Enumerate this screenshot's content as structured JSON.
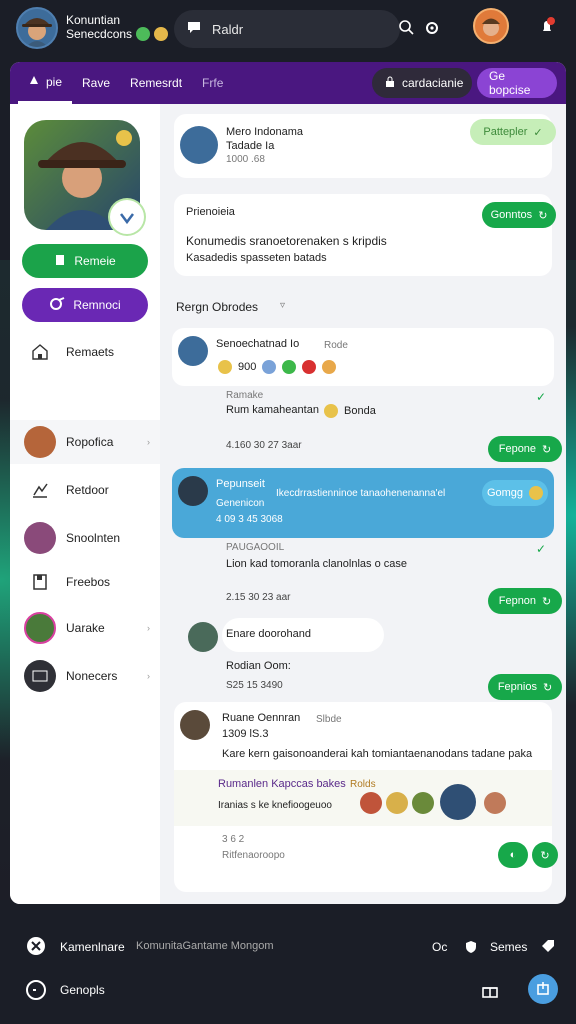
{
  "colors": {
    "brand_purple": "#4a1780",
    "accent_green": "#17a84a",
    "accent_purple": "#6a28b4",
    "highlight_blue": "#4aa8d8"
  },
  "header": {
    "title": "Konuntian",
    "subtitle": "Senecdcons",
    "search_placeholder": "Raldr",
    "icons": [
      "search-icon",
      "settings-icon",
      "notification-icon"
    ]
  },
  "tabs": [
    {
      "label": "pie",
      "icon": "grid-icon"
    },
    {
      "label": "Rave"
    },
    {
      "label": "Remesrdt"
    },
    {
      "label": "Frfe"
    }
  ],
  "tab_actions": {
    "secondary_label": "cardacianie",
    "primary_label": "Ge bopcise"
  },
  "sidebar": {
    "primary_button": "Remeie",
    "secondary_button": "Remnoci",
    "items": [
      {
        "label": "Remaets",
        "icon": "home-icon"
      },
      {
        "label": "Ropofica",
        "icon": "avatar"
      },
      {
        "label": "Retdoor",
        "icon": "chart-icon"
      },
      {
        "label": "Snoolnten",
        "icon": "avatar"
      },
      {
        "label": "Freebos",
        "icon": "document-icon"
      },
      {
        "label": "Uarake",
        "icon": "avatar"
      },
      {
        "label": "Nonecers",
        "icon": "board-icon"
      }
    ]
  },
  "feed": {
    "post1": {
      "name": "Mero Indonama",
      "meta1": "Tadade Ia",
      "meta2": "1000 .68",
      "badge": "Pattepler"
    },
    "summary": {
      "title": "Prienoieia",
      "line1": "Konumedis sranoetorenaken s kripdis",
      "line2": "Kasadedis spasseten batads",
      "button": "Gonntos"
    },
    "section_title": "Rergn Obrodes",
    "comment1": {
      "name": "Senoechatnad Io",
      "meta": "Rode",
      "count": "900"
    },
    "reply1": {
      "meta": "Ramake",
      "text": "Rum kamaheantan",
      "tag": "Bonda",
      "stats": "4.160  30  27 3aar",
      "button": "Fepone"
    },
    "highlight": {
      "name": "Pepunseit",
      "sub": "Genenicon",
      "stats": "4 09 3 45 3068",
      "message": "Ikecdrrastienninoe tanaohenenanna'el",
      "button": "Gomgg"
    },
    "reply2": {
      "meta": "PAUGAOOIL",
      "text": "Lion kad tomoranla clanolnlas o case",
      "stats": "2.15  30  23 aar",
      "button": "Fepnon"
    },
    "chip": {
      "text": "Enare doorohand"
    },
    "reply3": {
      "name": "Rodian Oom:",
      "stats": "S25  15  3490",
      "button": "Fepnios"
    },
    "post2": {
      "name": "Ruane Oennran",
      "meta": "Slbde",
      "meta2": "1309 lS.3",
      "text": "Kare kern gaisonoanderai kah tomiantaenanodans tadane paka",
      "subcard": "Rumanlen Kapccas bakes",
      "subcard_tag": "Rolds",
      "sub_meta": "Iranias s ke knefioogeuoo",
      "footer1": "3 6  2",
      "footer2": "Ritfenaoroopo"
    }
  },
  "bottombar": {
    "title": "Kamenlnare",
    "subtitle": "KomunitaGantame Mongom",
    "status": "Oc",
    "settings_label": "Semes",
    "footer_label": "Genopls"
  }
}
